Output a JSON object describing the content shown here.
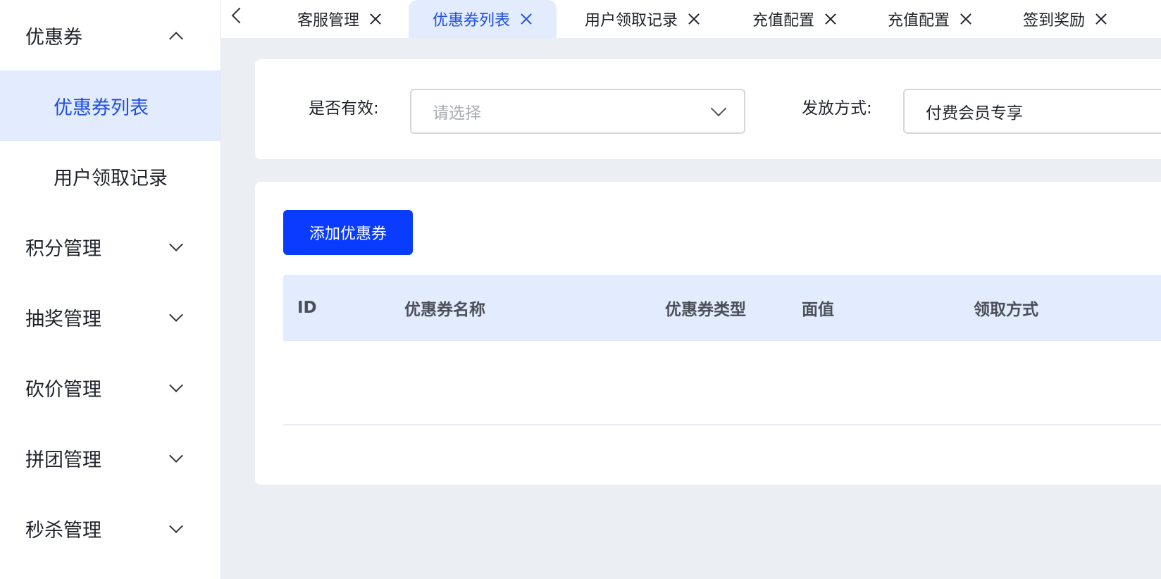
{
  "sidebar": {
    "groups": [
      {
        "label": "优惠券",
        "expanded": true,
        "items": [
          {
            "label": "优惠券列表",
            "active": true
          },
          {
            "label": "用户领取记录",
            "active": false
          }
        ]
      },
      {
        "label": "积分管理",
        "expanded": false
      },
      {
        "label": "抽奖管理",
        "expanded": false
      },
      {
        "label": "砍价管理",
        "expanded": false
      },
      {
        "label": "拼团管理",
        "expanded": false
      },
      {
        "label": "秒杀管理",
        "expanded": false
      }
    ]
  },
  "tabs": [
    {
      "label": "客服管理",
      "active": false
    },
    {
      "label": "优惠券列表",
      "active": true
    },
    {
      "label": "用户领取记录",
      "active": false
    },
    {
      "label": "充值配置",
      "active": false
    },
    {
      "label": "充值配置",
      "active": false
    },
    {
      "label": "签到奖励",
      "active": false
    }
  ],
  "filters": {
    "valid": {
      "label": "是否有效:",
      "placeholder": "请选择"
    },
    "issue_method": {
      "label": "发放方式:",
      "value": "付费会员专享"
    }
  },
  "actions": {
    "add_label": "添加优惠券"
  },
  "table": {
    "columns": [
      "ID",
      "优惠券名称",
      "优惠券类型",
      "面值",
      "领取方式"
    ],
    "rows": []
  },
  "colors": {
    "primary": "#0a3cff",
    "active_bg": "#e3ecff",
    "active_text": "#1f4fe0",
    "page_bg": "#ebeef2"
  }
}
